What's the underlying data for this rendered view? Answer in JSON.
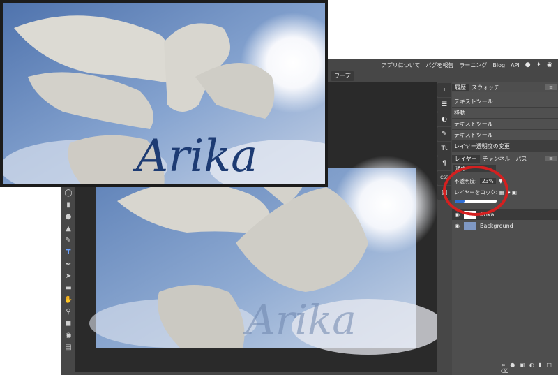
{
  "top_menu": {
    "items": [
      "アプリについて",
      "バグを報告",
      "ラーニング",
      "Blog",
      "API"
    ],
    "social_icons": [
      "reddit-icon",
      "twitter-icon",
      "facebook-icon"
    ]
  },
  "options_bar": {
    "warp_label": "ワープ"
  },
  "tools": [
    "lasso-icon",
    "rect-select-icon",
    "blur-icon",
    "sharpen-icon",
    "brush-icon",
    "text-tool-icon",
    "pen-icon",
    "path-select-icon",
    "shape-icon",
    "hand-icon",
    "zoom-icon",
    "color-swatch",
    "quickmask-icon",
    "screen-mode-icon"
  ],
  "text_tool_glyph": "T",
  "right_strip": {
    "icons": [
      "info-icon",
      "adjust-icon",
      "navigator-icon",
      "brush-preset-icon",
      "character-icon",
      "paragraph-icon",
      "css-icon",
      "image-icon"
    ],
    "labels": {
      "character": "Tt",
      "paragraph": "¶",
      "css": "CSS",
      "info": "i"
    }
  },
  "history_panel": {
    "tabs": [
      "履歴",
      "スウォッチ"
    ],
    "items": [
      "テキストツール",
      "移動",
      "テキストツール",
      "テキストツール",
      "レイヤー透明度の変更"
    ]
  },
  "layers_panel": {
    "tabs": [
      "レイヤー",
      "チャンネル",
      "パス"
    ],
    "blend_mode": "通常",
    "opacity_label": "不透明度:",
    "opacity_value": "23%",
    "lock_label": "レイヤーをロック:",
    "layers": [
      {
        "name": "Arika"
      },
      {
        "name": "Background"
      }
    ]
  },
  "canvas_text": "Arika",
  "overlay_text": "Arika",
  "colors": {
    "text_dark_blue": "#1d3b73",
    "highlight_circle": "#d42020",
    "app_bg": "#474747",
    "canvas_bg": "#2a2a2a"
  }
}
